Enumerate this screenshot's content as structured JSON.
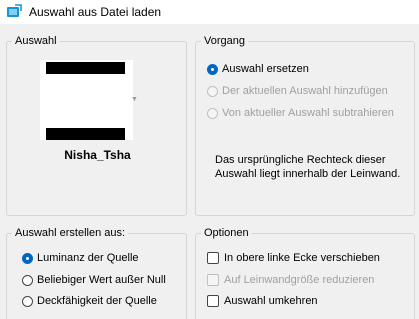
{
  "window": {
    "title": "Auswahl aus Datei laden",
    "icon": "selection-load-icon"
  },
  "auswahl": {
    "legend": "Auswahl",
    "preset_name": "Nisha_Tsha"
  },
  "vorgang": {
    "legend": "Vorgang",
    "options": [
      {
        "label": "Auswahl ersetzen",
        "checked": true,
        "enabled": true
      },
      {
        "label": "Der aktuellen Auswahl hinzufügen",
        "checked": false,
        "enabled": false
      },
      {
        "label": "Von aktueller Auswahl subtrahieren",
        "checked": false,
        "enabled": false
      }
    ],
    "description": "Das ursprüngliche Rechteck dieser Auswahl liegt innerhalb der Leinwand."
  },
  "erstellen": {
    "legend": "Auswahl erstellen aus:",
    "options": [
      {
        "label": "Luminanz der Quelle",
        "checked": true
      },
      {
        "label": "Beliebiger Wert außer Null",
        "checked": false
      },
      {
        "label": "Deckfähigkeit der Quelle",
        "checked": false
      }
    ]
  },
  "optionen": {
    "legend": "Optionen",
    "options": [
      {
        "label": "In obere linke Ecke verschieben",
        "checked": false,
        "enabled": true
      },
      {
        "label": "Auf Leinwandgröße reduzieren",
        "checked": false,
        "enabled": false
      },
      {
        "label": "Auswahl umkehren",
        "checked": false,
        "enabled": true
      }
    ]
  },
  "colors": {
    "accent": "#0067c0",
    "disabled_text": "#a0a0a0"
  }
}
